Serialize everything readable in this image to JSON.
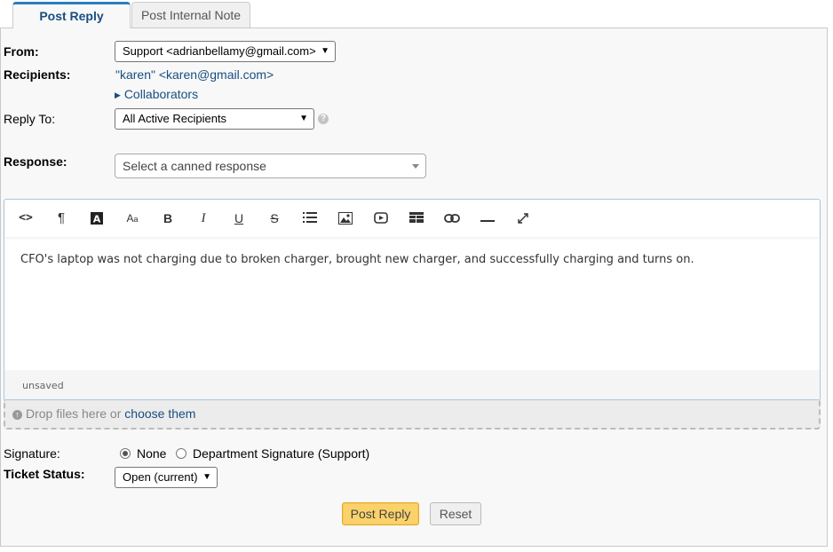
{
  "tabs": [
    {
      "label": "Post Reply",
      "active": true
    },
    {
      "label": "Post Internal Note",
      "active": false
    }
  ],
  "form": {
    "from_label": "From:",
    "from_value": "Support <adrianbellamy@gmail.com>",
    "recipients_label": "Recipients:",
    "recipient": "\"karen\" <karen@gmail.com>",
    "collaborators_label": "Collaborators",
    "reply_to_label": "Reply To:",
    "reply_to_value": "All Active Recipients",
    "response_label": "Response:",
    "response_placeholder": "Select a canned response"
  },
  "editor": {
    "content": "CFO's laptop was not charging due to broken charger, brought new charger, and successfully charging and turns on.",
    "status": "unsaved",
    "toolbar": [
      "code-view",
      "paragraph",
      "text-color",
      "font-size",
      "bold",
      "italic",
      "underline",
      "strikethrough",
      "list",
      "image",
      "video",
      "table",
      "link",
      "horizontal-rule",
      "fullscreen"
    ]
  },
  "dropzone": {
    "text": "Drop files here or ",
    "link": "choose them"
  },
  "signature": {
    "label": "Signature:",
    "options": [
      "None",
      "Department Signature (Support)"
    ],
    "selected": "None"
  },
  "ticket_status": {
    "label": "Ticket Status:",
    "value": "Open (current)"
  },
  "buttons": {
    "post_reply": "Post Reply",
    "reset": "Reset"
  },
  "colors": {
    "link": "#184e81",
    "primary_button": "#fbd26a",
    "active_tab_border": "#2a7fc0"
  }
}
